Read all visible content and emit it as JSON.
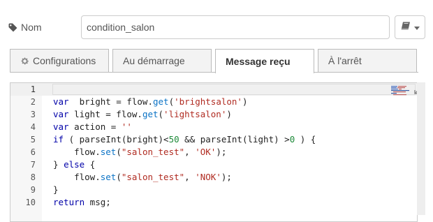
{
  "name_field": {
    "label": "Nom",
    "value": "condition_salon"
  },
  "icon_select": {
    "icon": "book-icon"
  },
  "tabs": [
    {
      "label": "Configurations",
      "icon": "gear-icon",
      "active": false
    },
    {
      "label": "Au démarrage",
      "active": false
    },
    {
      "label": "Message reçu",
      "active": true
    },
    {
      "label": "À l'arrêt",
      "active": false
    }
  ],
  "editor": {
    "active_line": 1,
    "lines": [
      {
        "n": "1",
        "tokens": []
      },
      {
        "n": "2",
        "tokens": [
          [
            "kw",
            "var"
          ],
          [
            "",
            "  bright = flow."
          ],
          [
            "prop",
            "get"
          ],
          [
            "",
            "("
          ],
          [
            "str",
            "'brightsalon'"
          ],
          [
            "",
            ")"
          ]
        ]
      },
      {
        "n": "3",
        "tokens": [
          [
            "kw",
            "var"
          ],
          [
            "",
            " light = flow."
          ],
          [
            "prop",
            "get"
          ],
          [
            "",
            "("
          ],
          [
            "str",
            "'lightsalon'"
          ],
          [
            "",
            ")"
          ]
        ]
      },
      {
        "n": "4",
        "tokens": [
          [
            "kw",
            "var"
          ],
          [
            "",
            " action = "
          ],
          [
            "str",
            "''"
          ]
        ]
      },
      {
        "n": "5",
        "tokens": [
          [
            "kw",
            "if"
          ],
          [
            "",
            " ( parseInt(bright)<"
          ],
          [
            "num",
            "50"
          ],
          [
            "",
            " && parseInt(light) >"
          ],
          [
            "num",
            "0"
          ],
          [
            "",
            " ) {"
          ]
        ]
      },
      {
        "n": "6",
        "tokens": [
          [
            "",
            "    flow."
          ],
          [
            "prop",
            "set"
          ],
          [
            "",
            "("
          ],
          [
            "str",
            "\"salon_test\""
          ],
          [
            "",
            ", "
          ],
          [
            "str",
            "'OK'"
          ],
          [
            "",
            ");"
          ]
        ]
      },
      {
        "n": "7",
        "tokens": [
          [
            "",
            "} "
          ],
          [
            "kw",
            "else"
          ],
          [
            "",
            " {"
          ]
        ]
      },
      {
        "n": "8",
        "tokens": [
          [
            "",
            "    flow."
          ],
          [
            "prop",
            "set"
          ],
          [
            "",
            "("
          ],
          [
            "str",
            "\"salon_test\""
          ],
          [
            "",
            ", "
          ],
          [
            "str",
            "'NOK'"
          ],
          [
            "",
            ");"
          ]
        ]
      },
      {
        "n": "9",
        "tokens": [
          [
            "",
            "}"
          ]
        ]
      },
      {
        "n": "10",
        "tokens": [
          [
            "kw",
            "return"
          ],
          [
            "",
            " msg;"
          ]
        ]
      }
    ]
  },
  "colors": {
    "keyword": "#0000a8",
    "property": "#0b73c6",
    "string": "#b02b21",
    "number": "#1d8a39"
  }
}
